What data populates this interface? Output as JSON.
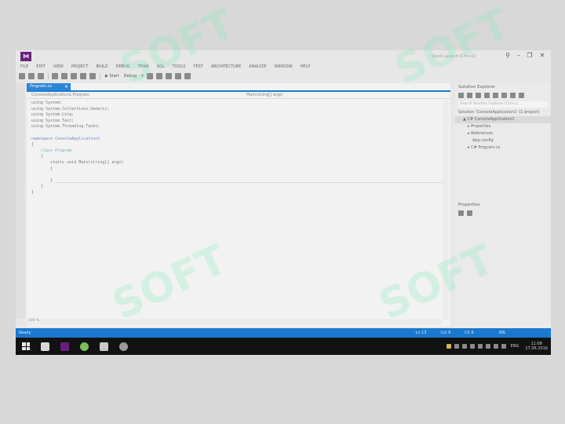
{
  "window": {
    "title": "",
    "quick_launch_placeholder": "Quick Launch (Ctrl+Q)",
    "controls": [
      "⚲",
      "–",
      "❐",
      "✕"
    ]
  },
  "menu": [
    "FILE",
    "EDIT",
    "VIEW",
    "PROJECT",
    "BUILD",
    "DEBUG",
    "TEAM",
    "SQL",
    "TOOLS",
    "TEST",
    "ARCHITECTURE",
    "ANALYZE",
    "WINDOW",
    "HELP"
  ],
  "toolbar": {
    "start_label": "▶ Start",
    "config_label": "Debug",
    "config_arrow": "▾"
  },
  "editor": {
    "tab_label": "Program.cs",
    "tab_close": "✕",
    "nav_left": "ConsoleApplication1.Program",
    "nav_right": "Main(string[] args)",
    "zoom": "100 %",
    "code": [
      "using System;",
      "using System.Collections.Generic;",
      "using System.Linq;",
      "using System.Text;",
      "using System.Threading.Tasks;",
      "",
      "namespace ConsoleApplication1",
      "{",
      "    class Program",
      "    {",
      "        static void Main(string[] args)",
      "        {",
      "",
      "        }",
      "    }",
      "}"
    ]
  },
  "solution_explorer": {
    "title": "Solution Explorer",
    "search_placeholder": "Search Solution Explorer (Ctrl+;)",
    "items": [
      {
        "label": "Solution 'ConsoleApplication1' (1 project)",
        "indent": 0
      },
      {
        "label": "▲ C# ConsoleApplication1",
        "indent": 1
      },
      {
        "label": "▸ Properties",
        "indent": 2
      },
      {
        "label": "▸ References",
        "indent": 2
      },
      {
        "label": "App.config",
        "indent": 2
      },
      {
        "label": "▸ C# Program.cs",
        "indent": 2
      }
    ]
  },
  "properties": {
    "title": "Properties"
  },
  "statusbar": {
    "left": "Ready",
    "ln": "Ln 13",
    "col": "Col 9",
    "ch": "Ch 9",
    "mode": "INS"
  },
  "taskbar": {
    "lang": "ENG",
    "time": "11:08",
    "date": "17.06.2016"
  },
  "watermark": "SOFT",
  "colors": {
    "accent": "#1a79cf",
    "vs_purple": "#68217a",
    "taskbar": "#121212"
  }
}
